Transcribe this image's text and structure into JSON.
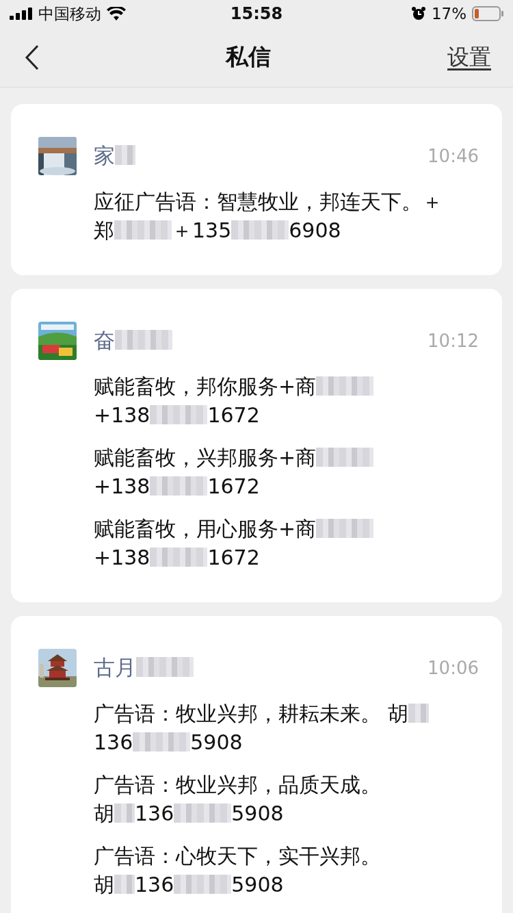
{
  "status_bar": {
    "carrier": "中国移动",
    "time": "15:58",
    "battery": "17%"
  },
  "nav": {
    "title": "私信",
    "action": "设置"
  },
  "conversations": [
    {
      "avatar": {
        "kind": "picture"
      },
      "name": [
        {
          "kind": "text",
          "text": "家"
        },
        {
          "kind": "blurshort"
        }
      ],
      "time": "10:46",
      "messages": [
        [
          [
            {
              "kind": "text",
              "text": "应征广告语：智慧牧业，邦连天下。＋"
            }
          ],
          [
            {
              "kind": "text",
              "text": "郑"
            },
            {
              "kind": "blurlong"
            },
            {
              "kind": "text",
              "text": "＋135"
            },
            {
              "kind": "blurlong"
            },
            {
              "kind": "text",
              "text": "6908"
            }
          ]
        ]
      ]
    },
    {
      "avatar": {
        "kind": "picture"
      },
      "name": [
        {
          "kind": "text",
          "text": "奋"
        },
        {
          "kind": "blurlong"
        }
      ],
      "time": "10:12",
      "messages": [
        [
          [
            {
              "kind": "text",
              "text": "赋能畜牧，邦你服务+商"
            },
            {
              "kind": "blurlong"
            }
          ],
          [
            {
              "kind": "text",
              "text": "+138"
            },
            {
              "kind": "blurlong"
            },
            {
              "kind": "text",
              "text": "1672"
            }
          ]
        ],
        [
          [
            {
              "kind": "text",
              "text": "赋能畜牧，兴邦服务+商"
            },
            {
              "kind": "blurlong"
            }
          ],
          [
            {
              "kind": "text",
              "text": "+138"
            },
            {
              "kind": "blurlong"
            },
            {
              "kind": "text",
              "text": "1672"
            }
          ]
        ],
        [
          [
            {
              "kind": "text",
              "text": "赋能畜牧，用心服务+商"
            },
            {
              "kind": "blurlong"
            }
          ],
          [
            {
              "kind": "text",
              "text": "+138"
            },
            {
              "kind": "blurlong"
            },
            {
              "kind": "text",
              "text": "1672"
            }
          ]
        ]
      ]
    },
    {
      "avatar": {
        "kind": "picture"
      },
      "name": [
        {
          "kind": "text",
          "text": "古月"
        },
        {
          "kind": "blurlong"
        }
      ],
      "time": "10:06",
      "messages": [
        [
          [
            {
              "kind": "text",
              "text": "广告语：牧业兴邦，耕耘未来。 胡"
            },
            {
              "kind": "blurshort"
            }
          ],
          [
            {
              "kind": "text",
              "text": "136"
            },
            {
              "kind": "blurlong"
            },
            {
              "kind": "text",
              "text": "5908"
            }
          ]
        ],
        [
          [
            {
              "kind": "text",
              "text": "广告语：牧业兴邦，品质天成。"
            }
          ],
          [
            {
              "kind": "text",
              "text": "胡"
            },
            {
              "kind": "blurshort"
            },
            {
              "kind": "text",
              "text": "136"
            },
            {
              "kind": "blurlong"
            },
            {
              "kind": "text",
              "text": "5908"
            }
          ]
        ],
        [
          [
            {
              "kind": "text",
              "text": "广告语：心牧天下，实干兴邦。"
            }
          ],
          [
            {
              "kind": "text",
              "text": "胡"
            },
            {
              "kind": "blurshort"
            },
            {
              "kind": "text",
              "text": "136"
            },
            {
              "kind": "blurlong"
            },
            {
              "kind": "text",
              "text": "5908"
            }
          ]
        ]
      ]
    }
  ]
}
